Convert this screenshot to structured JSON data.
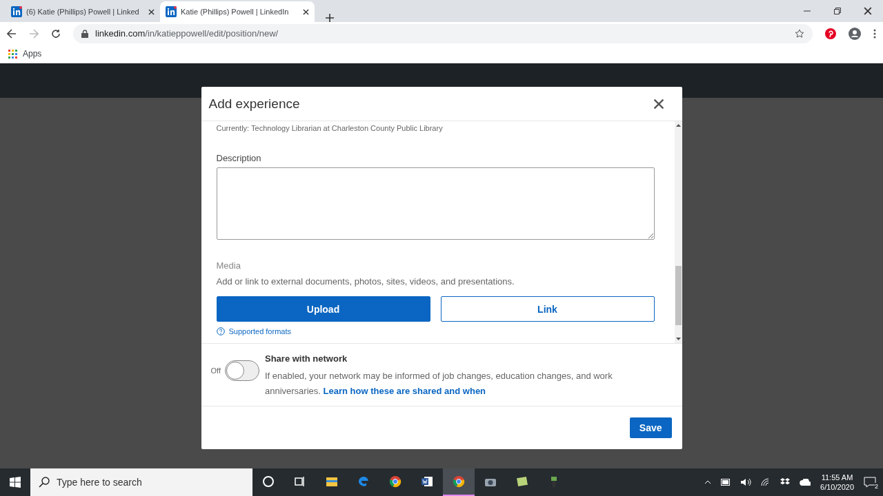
{
  "browser": {
    "tabs": [
      {
        "title": "(6) Katie (Phillips) Powell | Linked",
        "selected": false
      },
      {
        "title": "Katie (Phillips) Powell | LinkedIn",
        "selected": true
      }
    ],
    "url_host": "linkedin.com",
    "url_path": "/in/katieppowell/edit/position/new/",
    "bookmarks": [
      "Apps"
    ]
  },
  "dialog": {
    "title": "Add experience",
    "currently": "Currently: Technology Librarian at Charleston County Public Library",
    "description": {
      "label": "Description"
    },
    "media": {
      "label": "Media",
      "hint": "Add or link to external documents, photos, sites, videos, and presentations.",
      "buttons": [
        {
          "label": "Upload",
          "kind": "primary"
        },
        {
          "label": "Link",
          "kind": "secondary"
        }
      ],
      "formats_link": "Supported formats"
    },
    "share": {
      "state_label": "Off",
      "on": false,
      "title": "Share with network",
      "text": "If enabled, your network may be informed of job changes, education changes, and work anniversaries.",
      "link": "Learn how these are shared and when"
    },
    "save": "Save"
  },
  "taskbar": {
    "search_placeholder": "Type here to search",
    "apps": [
      {
        "kind": "cortana",
        "selected": false
      },
      {
        "kind": "taskview",
        "selected": false
      },
      {
        "kind": "folder",
        "selected": false
      },
      {
        "kind": "edge",
        "selected": false
      },
      {
        "kind": "chrome",
        "selected": false
      },
      {
        "kind": "word",
        "selected": false
      },
      {
        "kind": "chrome",
        "selected": true
      },
      {
        "kind": "camera",
        "selected": false
      },
      {
        "kind": "notes",
        "selected": false
      },
      {
        "kind": "tool",
        "selected": false
      }
    ],
    "time": "11:55 AM",
    "date": "6/10/2020",
    "notifications": "2"
  }
}
